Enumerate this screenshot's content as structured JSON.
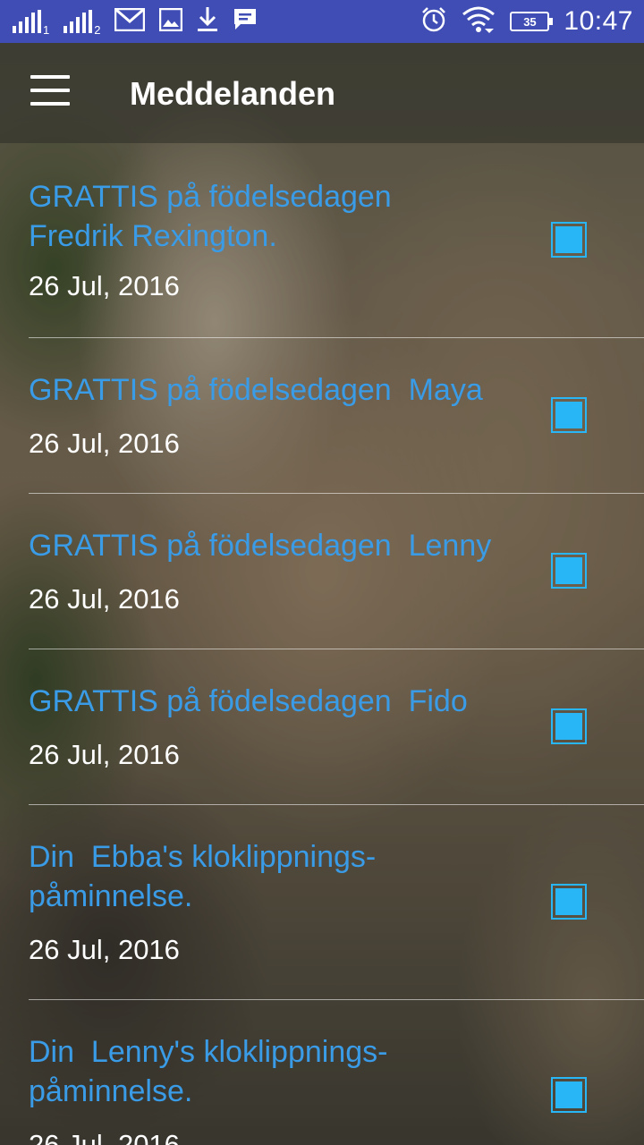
{
  "statusbar": {
    "sim1_label": "1",
    "sim2_label": "2",
    "battery_level": "35",
    "time": "10:47",
    "icons": [
      "signal-icon",
      "signal-icon",
      "gmail-icon",
      "image-icon",
      "download-icon",
      "message-icon",
      "alarm-icon",
      "wifi-icon",
      "battery-icon"
    ]
  },
  "appbar": {
    "menu_icon": "hamburger-menu-icon",
    "title": "Meddelanden"
  },
  "notifications": [
    {
      "title": "GRATTIS på födelsedagen\nFredrik Rexington.",
      "date": "26 Jul, 2016",
      "checked": true
    },
    {
      "title": "GRATTIS på födelsedagen  Maya",
      "date": "26 Jul, 2016",
      "checked": true
    },
    {
      "title": "GRATTIS på födelsedagen  Lenny",
      "date": "26 Jul, 2016",
      "checked": true
    },
    {
      "title": "GRATTIS på födelsedagen  Fido",
      "date": "26 Jul, 2016",
      "checked": true
    },
    {
      "title": "Din  Ebba's kloklippnings-\npåminnelse.",
      "date": "26 Jul, 2016",
      "checked": true
    },
    {
      "title": "Din  Lenny's kloklippnings-\npåminnelse.",
      "date": "26 Jul, 2016",
      "checked": true
    }
  ],
  "colors": {
    "statusbar": "#3f4db5",
    "title_text": "#3a9be6",
    "checkbox": "#29b6f6"
  }
}
